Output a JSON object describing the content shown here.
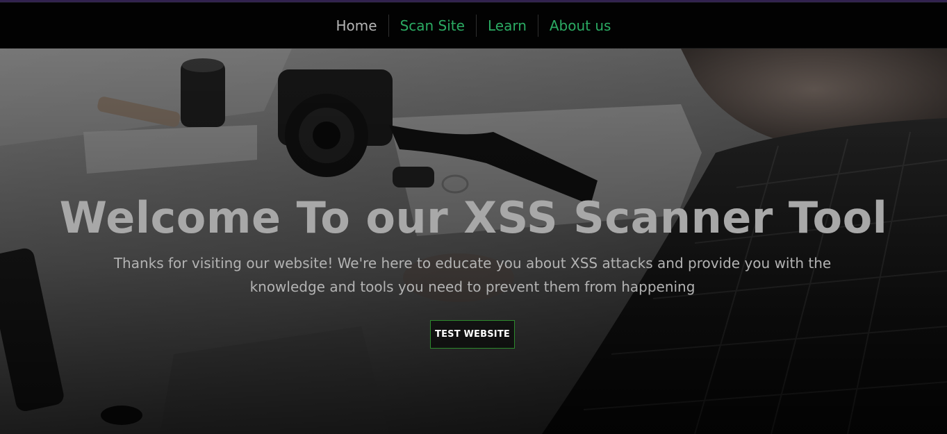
{
  "nav": {
    "items": [
      {
        "label": "Home"
      },
      {
        "label": "Scan Site"
      },
      {
        "label": "Learn"
      },
      {
        "label": "About us"
      }
    ]
  },
  "hero": {
    "title": "Welcome To our XSS Scanner Tool",
    "description": "Thanks for visiting our website! We're here to educate you about XSS attacks and provide you with the knowledge and tools you need to prevent them from happening",
    "button_label": "TEST WEBSITE"
  },
  "colors": {
    "nav_active_text": "#b5b5b5",
    "nav_link_text": "#2bab63",
    "button_border": "#2c8a2c",
    "title_text": "#a8a8a8"
  }
}
